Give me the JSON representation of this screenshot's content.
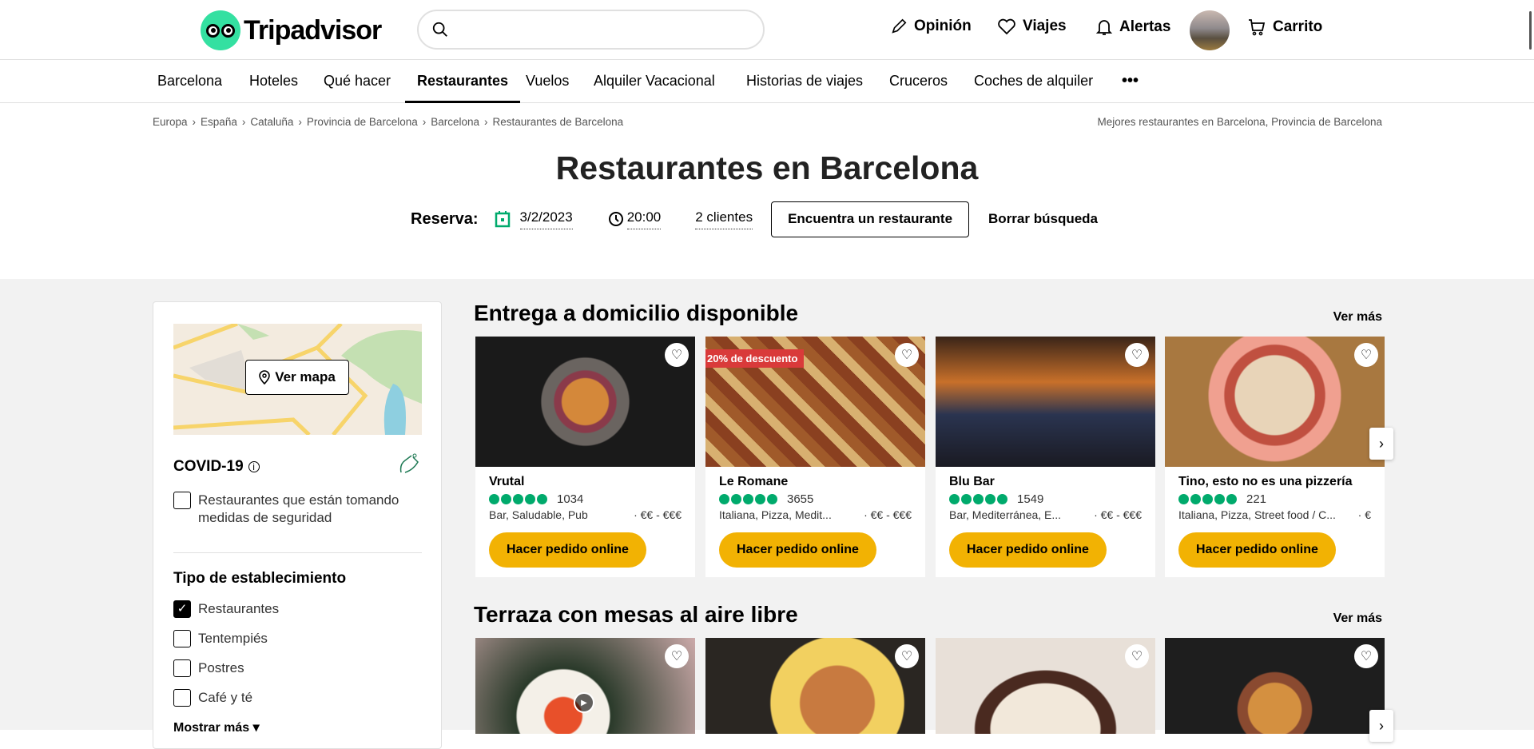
{
  "header": {
    "logo": "Tripadvisor",
    "search_placeholder": "",
    "nav": [
      {
        "label": "Opinión",
        "icon": "pencil-icon"
      },
      {
        "label": "Viajes",
        "icon": "heart-icon"
      },
      {
        "label": "Alertas",
        "icon": "bell-icon"
      },
      {
        "label": "Carrito",
        "icon": "cart-icon"
      }
    ]
  },
  "nav": {
    "items": [
      "Barcelona",
      "Hoteles",
      "Qué hacer",
      "Restaurantes",
      "Vuelos",
      "Alquiler Vacacional",
      "Historias de viajes",
      "Cruceros",
      "Coches de alquiler"
    ],
    "active": "Restaurantes",
    "more": "•••"
  },
  "breadcrumb": [
    "Europa",
    "España",
    "Cataluña",
    "Provincia de Barcelona",
    "Barcelona",
    "Restaurantes de Barcelona"
  ],
  "breadcrumb_right": "Mejores restaurantes en Barcelona, Provincia de Barcelona",
  "page_title": "Restaurantes en Barcelona",
  "reserve": {
    "label": "Reserva:",
    "date": "3/2/2023",
    "time": "20:00",
    "guests": "2 clientes",
    "find": "Encuentra un restaurante",
    "clear": "Borrar búsqueda"
  },
  "sidebar": {
    "map_button": "Ver mapa",
    "covid_title": "COVID-19",
    "covid_option": "Restaurantes que están tomando medidas de seguridad",
    "type_title": "Tipo de establecimiento",
    "types": [
      {
        "label": "Restaurantes",
        "checked": true
      },
      {
        "label": "Tentempiés",
        "checked": false
      },
      {
        "label": "Postres",
        "checked": false
      },
      {
        "label": "Café y té",
        "checked": false
      }
    ],
    "show_more": "Mostrar más"
  },
  "sections": [
    {
      "title": "Entrega a domicilio disponible",
      "more": "Ver más",
      "cards": [
        {
          "name": "Vrutal",
          "rating": 5,
          "reviews": "1034",
          "cuisine": "Bar, Saludable, Pub",
          "price": "· €€ - €€€",
          "button": "Hacer pedido online"
        },
        {
          "name": "Le Romane",
          "rating": 5,
          "reviews": "3655",
          "cuisine": "Italiana, Pizza, Medit...",
          "price": "· €€ - €€€",
          "button": "Hacer pedido online",
          "badge": "20% de descuento"
        },
        {
          "name": "Blu Bar",
          "rating": 5,
          "reviews": "1549",
          "cuisine": "Bar, Mediterránea, E...",
          "price": "· €€ - €€€",
          "button": "Hacer pedido online"
        },
        {
          "name": "Tino, esto no es una pizzería",
          "rating": 5,
          "reviews": "221",
          "cuisine": "Italiana, Pizza, Street food / C...",
          "price": "· €",
          "button": "Hacer pedido online"
        }
      ]
    },
    {
      "title": "Terraza con mesas al aire libre",
      "more": "Ver más"
    }
  ],
  "colors": {
    "brand": "#34e0a1",
    "rating": "#00aa6c",
    "order_button": "#f2b203",
    "badge": "#d93a3a"
  }
}
